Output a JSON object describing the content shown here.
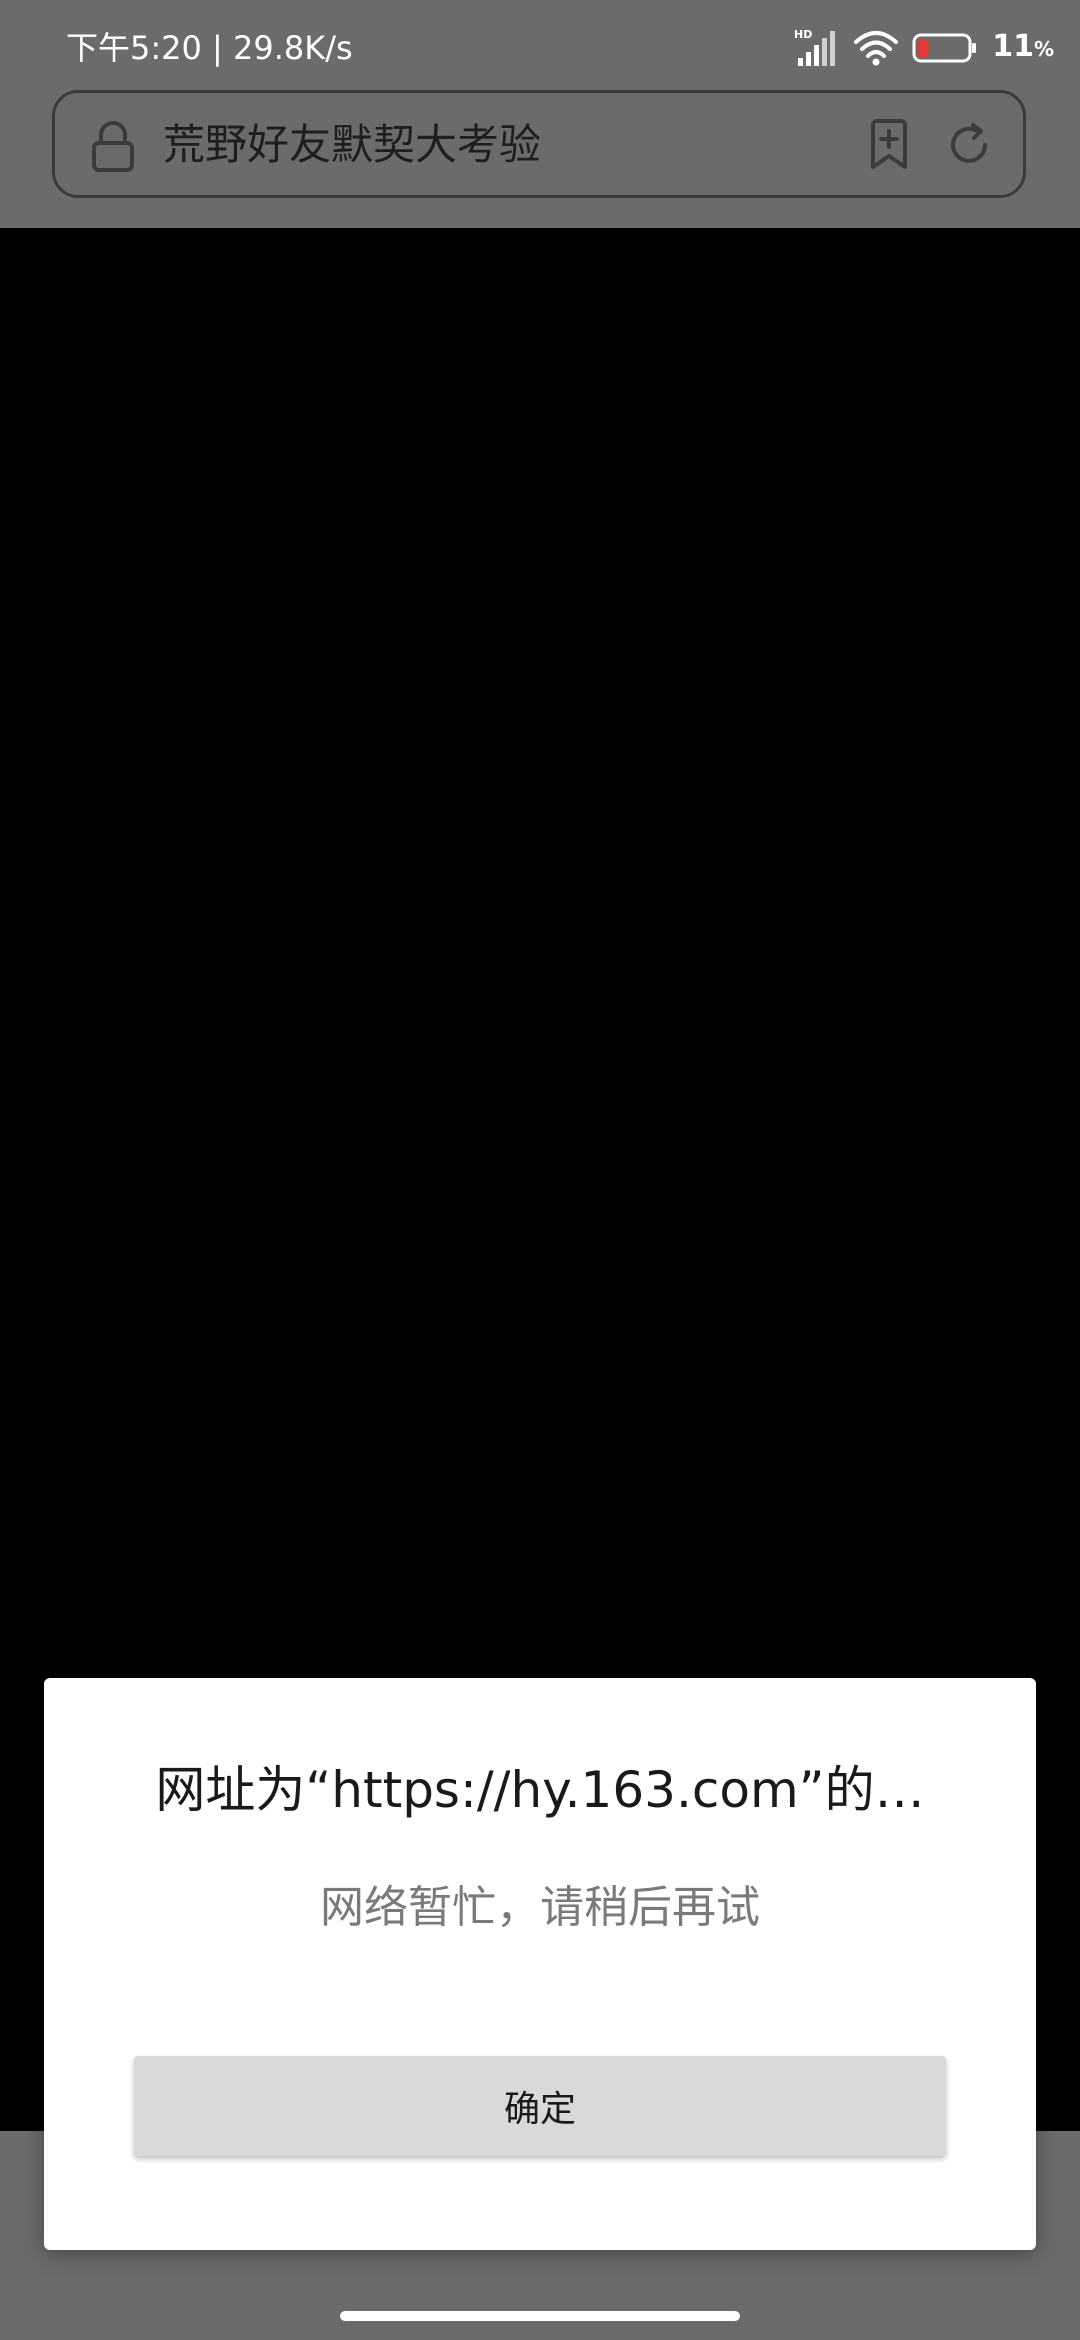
{
  "status_bar": {
    "time_speed": "下午5:20 | 29.8K/s",
    "network_badge": "HD",
    "battery_percent": "11",
    "battery_unit": "%",
    "battery_level": 0.11,
    "battery_color": "#e53935",
    "icons": [
      "signal-icon",
      "wifi-icon",
      "battery-icon"
    ]
  },
  "browser": {
    "page_title": "荒野好友默契大考验",
    "icons": [
      "lock-icon",
      "bookmark-add-icon",
      "refresh-icon"
    ]
  },
  "dialog": {
    "title": "网址为“https://hy.163.com”的…",
    "message": "网络暂忙，请稍后再试",
    "confirm_label": "确定"
  }
}
